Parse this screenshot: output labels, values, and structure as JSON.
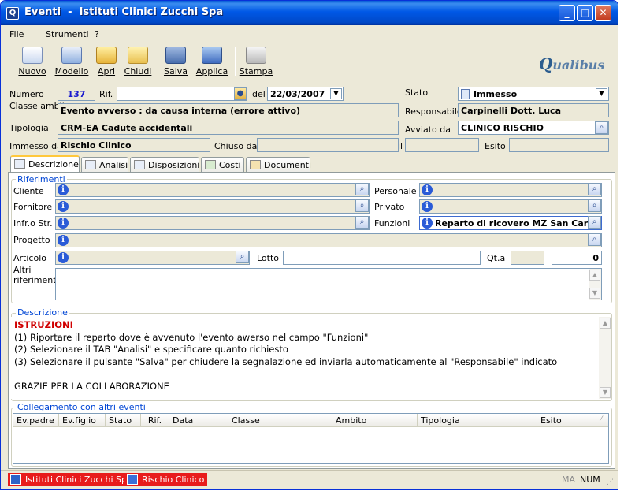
{
  "window": {
    "title": "Eventi  -  Istituti Clinici Zucchi Spa"
  },
  "menu": [
    "File",
    "Strumenti",
    "?"
  ],
  "toolbar": {
    "nuovo": "Nuovo",
    "modello": "Modello",
    "apri": "Apri",
    "chiudi": "Chiudi",
    "salva": "Salva",
    "applica": "Applica",
    "stampa": "Stampa"
  },
  "logo": {
    "text_main": "Q",
    "text_rest": "ualibus"
  },
  "header": {
    "numero_label": "Numero",
    "numero_value": "137",
    "rif_label": "Rif.",
    "rif_value": "",
    "del_label": "del",
    "del_value": "22/03/2007",
    "stato_label": "Stato",
    "stato_value": "Immesso",
    "classe_label": "Classe ambito",
    "classe_value": "Evento avverso : da causa interna (errore attivo)",
    "responsabile_label": "Responsabile",
    "responsabile_value": "Carpinelli Dott. Luca",
    "tipologia_label": "Tipologia",
    "tipologia_value": "CRM-EA Cadute accidentali",
    "avviato_label": "Avviato da",
    "avviato_value": "CLINICO RISCHIO",
    "immesso_label": "Immesso da",
    "immesso_value": "Rischio Clinico",
    "chiuso_label": "Chiuso da",
    "chiuso_value": "",
    "il_label": "il",
    "il_value": "",
    "esito_label": "Esito",
    "esito_value": ""
  },
  "tabs": [
    "Descrizione",
    "Analisi",
    "Disposizioni",
    "Costi",
    "Documenti"
  ],
  "riferimenti": {
    "title": "Riferimenti",
    "cliente": "Cliente",
    "fornitore": "Fornitore",
    "infro": "Infr.o Str.",
    "progetto": "Progetto",
    "articolo": "Articolo",
    "altri": "Altri riferimenti",
    "personale": "Personale",
    "privato": "Privato",
    "funzioni": "Funzioni",
    "funzioni_value": "Reparto di ricovero MZ San Carlo",
    "lotto": "Lotto",
    "lotto_value": "",
    "qta": "Qt.a",
    "qta_value": "0"
  },
  "descrizione": {
    "title": "Descrizione",
    "heading": "ISTRUZIONI",
    "line1": "(1) Riportare il reparto dove è avvenuto l'evento awerso nel campo \"Funzioni\"",
    "line2": "(2) Selezionare il TAB \"Analisi\" e specificare quanto richiesto",
    "line3": "(3) Selezionare il pulsante \"Salva\" per chiudere la segnalazione ed inviarla automaticamente al \"Responsabile\" indicato",
    "line4": "",
    "line5": "GRAZIE PER LA COLLABORAZIONE"
  },
  "collegamento": {
    "title": "Collegamento con altri eventi",
    "columns": [
      "Ev.padre",
      "Ev.figlio",
      "Stato",
      "Rif.",
      "Data",
      "Classe",
      "Ambito",
      "Tipologia",
      "Esito"
    ]
  },
  "statusbar": {
    "company": "Istituti Clinici Zucchi Spa",
    "user": "Rischio Clinico",
    "ma": "MA",
    "num": "NUM"
  }
}
